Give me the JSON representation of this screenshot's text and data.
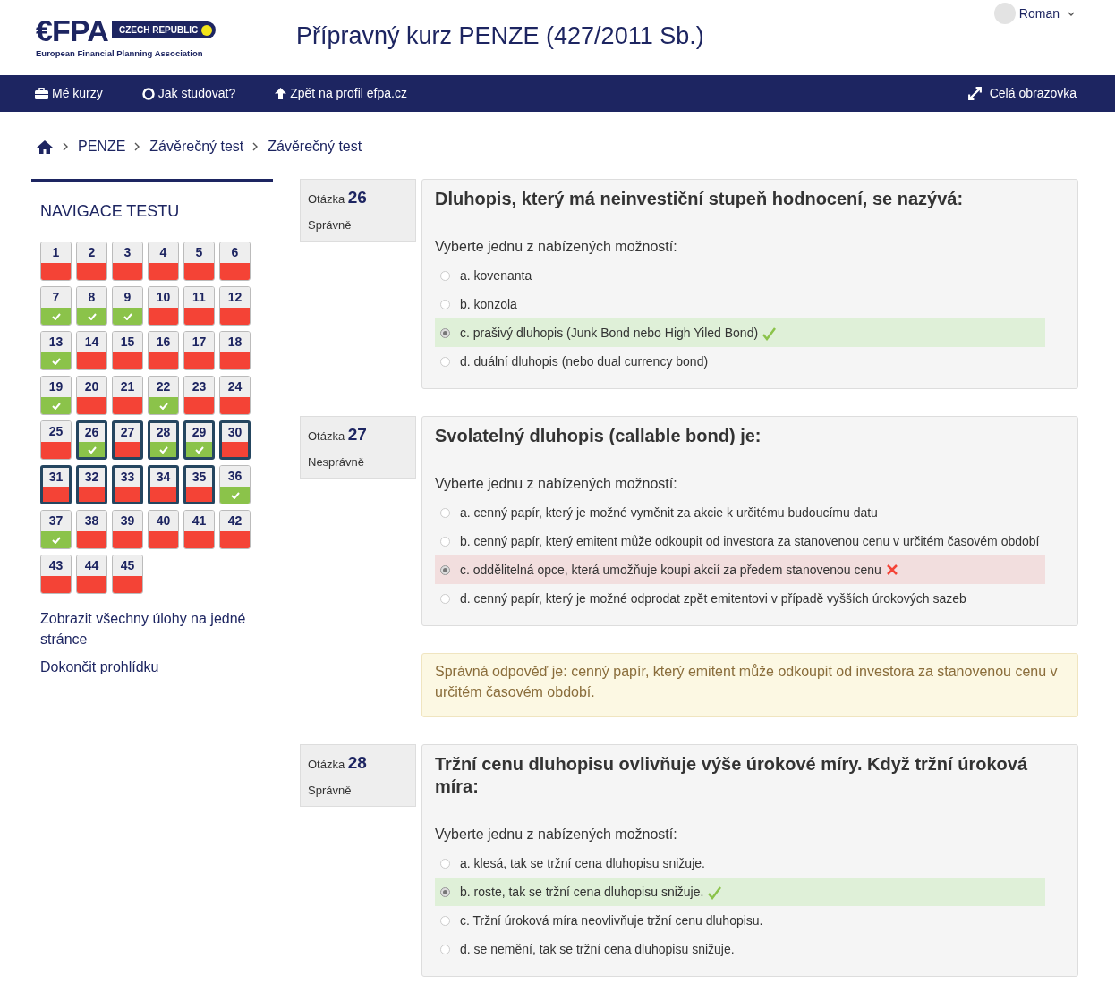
{
  "logo": {
    "mark": "€FPA",
    "country": "CZECH REPUBLIC",
    "subtitle": "European Financial Planning Association"
  },
  "page_title": "Přípravný kurz PENZE (427/2011 Sb.)",
  "user": {
    "name": "Roman"
  },
  "menu": [
    {
      "label": "Mé kurzy"
    },
    {
      "label": "Jak studovat?"
    },
    {
      "label": "Zpět na profil efpa.cz"
    }
  ],
  "fullscreen": {
    "label": "Celá obrazovka"
  },
  "breadcrumb": [
    "PENZE",
    "Závěrečný test",
    "Závěrečný test"
  ],
  "quiz_nav": {
    "title": "NAVIGACE TESTU",
    "items": [
      {
        "label": "1",
        "correct": false,
        "current": false
      },
      {
        "label": "2",
        "correct": false,
        "current": false
      },
      {
        "label": "3",
        "correct": false,
        "current": false
      },
      {
        "label": "4",
        "correct": false,
        "current": false
      },
      {
        "label": "5",
        "correct": false,
        "current": false
      },
      {
        "label": "6",
        "correct": false,
        "current": false
      },
      {
        "label": "7",
        "correct": true,
        "current": false
      },
      {
        "label": "8",
        "correct": true,
        "current": false
      },
      {
        "label": "9",
        "correct": true,
        "current": false
      },
      {
        "label": "10",
        "correct": false,
        "current": false
      },
      {
        "label": "11",
        "correct": false,
        "current": false
      },
      {
        "label": "12",
        "correct": false,
        "current": false
      },
      {
        "label": "13",
        "correct": true,
        "current": false
      },
      {
        "label": "14",
        "correct": false,
        "current": false
      },
      {
        "label": "15",
        "correct": false,
        "current": false
      },
      {
        "label": "16",
        "correct": false,
        "current": false
      },
      {
        "label": "17",
        "correct": false,
        "current": false
      },
      {
        "label": "18",
        "correct": false,
        "current": false
      },
      {
        "label": "19",
        "correct": true,
        "current": false
      },
      {
        "label": "20",
        "correct": false,
        "current": false
      },
      {
        "label": "21",
        "correct": false,
        "current": false
      },
      {
        "label": "22",
        "correct": true,
        "current": false
      },
      {
        "label": "23",
        "correct": false,
        "current": false
      },
      {
        "label": "24",
        "correct": false,
        "current": false
      },
      {
        "label": "25",
        "correct": false,
        "current": false
      },
      {
        "label": "26",
        "correct": true,
        "current": true
      },
      {
        "label": "27",
        "correct": false,
        "current": true
      },
      {
        "label": "28",
        "correct": true,
        "current": true
      },
      {
        "label": "29",
        "correct": true,
        "current": true
      },
      {
        "label": "30",
        "correct": false,
        "current": true
      },
      {
        "label": "31",
        "correct": false,
        "current": true
      },
      {
        "label": "32",
        "correct": false,
        "current": true
      },
      {
        "label": "33",
        "correct": false,
        "current": true
      },
      {
        "label": "34",
        "correct": false,
        "current": true
      },
      {
        "label": "35",
        "correct": false,
        "current": true
      },
      {
        "label": "36",
        "correct": true,
        "current": false
      },
      {
        "label": "37",
        "correct": true,
        "current": false
      },
      {
        "label": "38",
        "correct": false,
        "current": false
      },
      {
        "label": "39",
        "correct": false,
        "current": false
      },
      {
        "label": "40",
        "correct": false,
        "current": false
      },
      {
        "label": "41",
        "correct": false,
        "current": false
      },
      {
        "label": "42",
        "correct": false,
        "current": false
      },
      {
        "label": "43",
        "correct": false,
        "current": false
      },
      {
        "label": "44",
        "correct": false,
        "current": false
      },
      {
        "label": "45",
        "correct": false,
        "current": false
      }
    ],
    "links": [
      "Zobrazit všechny úlohy na jedné stránce",
      "Dokončit prohlídku"
    ]
  },
  "questions": [
    {
      "label": "Otázka",
      "number": "26",
      "status": "Správně",
      "text": "Dluhopis, který má neinvestiční stupeň hodnocení, se nazývá:",
      "prompt": "Vyberte jednu z nabízených možností:",
      "options": [
        {
          "text": "a. kovenanta",
          "selected": false,
          "kind": "plain"
        },
        {
          "text": "b. konzola",
          "selected": false,
          "kind": "plain"
        },
        {
          "text": "c. prašivý dluhopis (Junk Bond nebo High Yiled Bond)",
          "selected": true,
          "kind": "correct"
        },
        {
          "text": "d. duální dluhopis (nebo dual currency bond)",
          "selected": false,
          "kind": "plain"
        }
      ]
    },
    {
      "label": "Otázka",
      "number": "27",
      "status": "Nesprávně",
      "text": "Svolatelný dluhopis (callable bond) je:",
      "prompt": "Vyberte jednu z nabízených možností:",
      "options": [
        {
          "text": "a. cenný papír, který je možné vyměnit za akcie k určitému budoucímu datu",
          "selected": false,
          "kind": "plain"
        },
        {
          "text": "b. cenný papír, který emitent může odkoupit od investora za stanovenou cenu v určitém časovém období",
          "selected": false,
          "kind": "plain"
        },
        {
          "text": "c. oddělitelná opce, která umožňuje koupi akcií za předem stanovenou cenu",
          "selected": true,
          "kind": "incorrect"
        },
        {
          "text": "d. cenný papír, který je možné odprodat zpět emitentovi v případě vyšších úrokových sazeb",
          "selected": false,
          "kind": "plain"
        }
      ],
      "feedback": "Správná odpověď je: cenný papír, který emitent může odkoupit od investora za stanovenou cenu v určitém časovém období."
    },
    {
      "label": "Otázka",
      "number": "28",
      "status": "Správně",
      "text": "Tržní cenu dluhopisu ovlivňuje výše úrokové míry. Když tržní úroková míra:",
      "prompt": "Vyberte jednu z nabízených možností:",
      "options": [
        {
          "text": "a. klesá, tak se tržní cena dluhopisu snižuje.",
          "selected": false,
          "kind": "plain"
        },
        {
          "text": "b. roste, tak se tržní cena dluhopisu snižuje.",
          "selected": true,
          "kind": "correct"
        },
        {
          "text": "c. Tržní úroková míra neovlivňuje tržní cenu dluhopisu.",
          "selected": false,
          "kind": "plain"
        },
        {
          "text": "d. se nemění, tak se tržní cena dluhopisu snižuje.",
          "selected": false,
          "kind": "plain"
        }
      ]
    }
  ]
}
